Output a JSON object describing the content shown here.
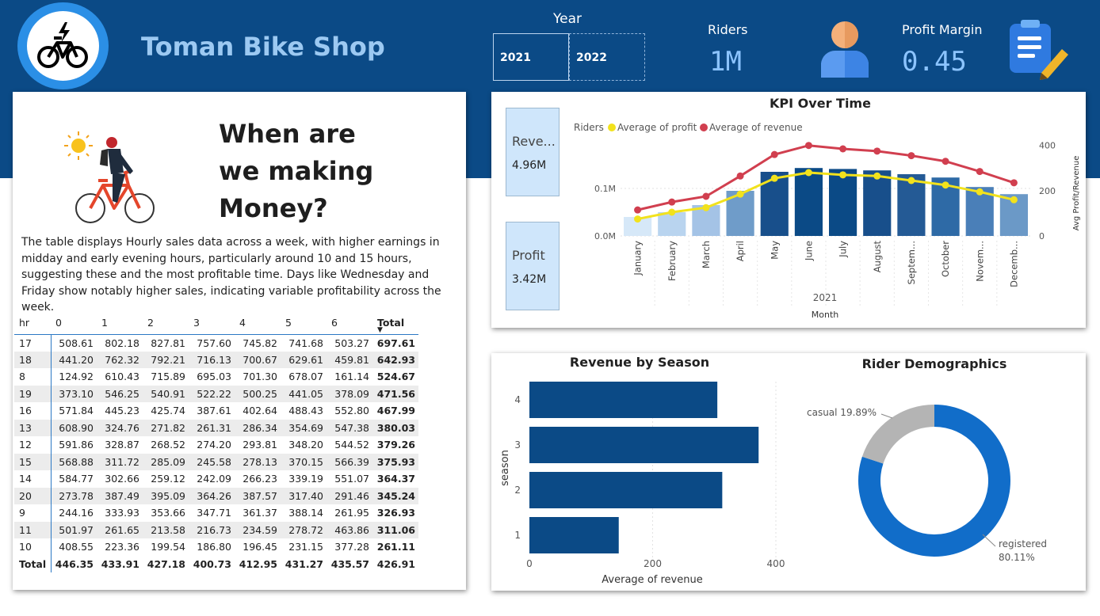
{
  "header": {
    "title": "Toman Bike Shop",
    "year_label": "Year",
    "years": [
      "2021",
      "2022"
    ],
    "selected_year": "2021",
    "riders_label": "Riders",
    "riders_value": "1M",
    "profit_margin_label": "Profit Margin",
    "profit_margin_value": "0.45",
    "icons": [
      "bike-logo-icon",
      "user-icon",
      "clipboard-icon"
    ]
  },
  "info_card": {
    "headline_lines": [
      "When are",
      "we making",
      "Money?"
    ],
    "description": "The table displays Hourly sales data across a week, with higher earnings in midday and early evening hours, particularly around 10 and 15 hours, suggesting these and the most profitable time. Days like Wednesday and Friday show notably higher sales, indicating variable profitability across the week."
  },
  "hourly_table": {
    "columns": [
      "hr",
      "0",
      "1",
      "2",
      "3",
      "4",
      "5",
      "6",
      "Total"
    ],
    "sorted_column": "Total",
    "rows": [
      [
        "17",
        "508.61",
        "802.18",
        "827.81",
        "757.60",
        "745.82",
        "741.68",
        "503.27",
        "697.61"
      ],
      [
        "18",
        "441.20",
        "762.32",
        "792.21",
        "716.13",
        "700.67",
        "629.61",
        "459.81",
        "642.93"
      ],
      [
        "8",
        "124.92",
        "610.43",
        "715.89",
        "695.03",
        "701.30",
        "678.07",
        "161.14",
        "524.67"
      ],
      [
        "19",
        "373.10",
        "546.25",
        "540.91",
        "522.22",
        "500.25",
        "441.05",
        "378.09",
        "471.56"
      ],
      [
        "16",
        "571.84",
        "445.23",
        "425.74",
        "387.61",
        "402.64",
        "488.43",
        "552.80",
        "467.99"
      ],
      [
        "13",
        "608.90",
        "324.76",
        "271.82",
        "261.31",
        "286.34",
        "354.69",
        "547.38",
        "380.03"
      ],
      [
        "12",
        "591.86",
        "328.87",
        "268.52",
        "274.20",
        "293.81",
        "348.20",
        "544.52",
        "379.26"
      ],
      [
        "15",
        "568.88",
        "311.72",
        "285.09",
        "245.58",
        "278.13",
        "370.15",
        "566.39",
        "375.93"
      ],
      [
        "14",
        "584.77",
        "302.66",
        "259.12",
        "242.09",
        "266.23",
        "339.19",
        "551.07",
        "364.37"
      ],
      [
        "20",
        "273.78",
        "387.49",
        "395.09",
        "364.26",
        "387.57",
        "317.40",
        "291.46",
        "345.24"
      ],
      [
        "9",
        "244.16",
        "333.93",
        "353.66",
        "347.71",
        "361.37",
        "388.14",
        "261.95",
        "326.93"
      ],
      [
        "11",
        "501.97",
        "261.65",
        "213.58",
        "216.73",
        "234.59",
        "278.72",
        "463.86",
        "311.06"
      ],
      [
        "10",
        "408.55",
        "223.36",
        "199.54",
        "186.80",
        "196.45",
        "231.15",
        "377.28",
        "261.11"
      ]
    ],
    "total_row": [
      "Total",
      "446.35",
      "433.91",
      "427.18",
      "400.73",
      "412.95",
      "431.27",
      "435.57",
      "426.91"
    ]
  },
  "kpi_cards": {
    "revenue_label": "Reve...",
    "revenue_value": "4.96M",
    "profit_label": "Profit",
    "profit_value": "3.42M"
  },
  "colors": {
    "header_bg": "#0b4a86",
    "riders_bar": "#0b4a86",
    "profit_line": "#f2e21c",
    "revenue_line": "#d13f4f",
    "season_bar": "#0b4a86",
    "registered": "#116dc9",
    "casual": "#b4b4b4"
  },
  "chart_data": [
    {
      "type": "bar",
      "title": "KPI Over Time",
      "legend": [
        "Riders",
        "Average of profit",
        "Average of revenue"
      ],
      "legend_position": "top-left",
      "categories": [
        "January",
        "February",
        "March",
        "April",
        "May",
        "June",
        "July",
        "August",
        "Septem...",
        "October",
        "Novem...",
        "Decemb..."
      ],
      "xlabel": "Month",
      "x_group_label": "2021",
      "y_left_ticks": [
        "0.0M",
        "0.1M"
      ],
      "y_left_range": [
        0,
        0.2
      ],
      "y_right_label": "Avg Profit/Revenue",
      "y_right_ticks": [
        "0",
        "200",
        "400"
      ],
      "y_right_range": [
        0,
        420
      ],
      "series": [
        {
          "name": "Riders",
          "values": [
            0.04,
            0.05,
            0.065,
            0.095,
            0.135,
            0.143,
            0.141,
            0.138,
            0.13,
            0.123,
            0.103,
            0.088
          ]
        },
        {
          "name": "Average of profit",
          "values": [
            75,
            105,
            125,
            185,
            255,
            280,
            270,
            265,
            245,
            225,
            195,
            160
          ]
        },
        {
          "name": "Average of revenue",
          "values": [
            115,
            150,
            175,
            265,
            360,
            400,
            385,
            375,
            355,
            330,
            285,
            235
          ]
        }
      ],
      "grid": true
    },
    {
      "type": "bar",
      "orientation": "horizontal",
      "title": "Revenue by Season",
      "categories": [
        "4",
        "3",
        "2",
        "1"
      ],
      "values": [
        305,
        372,
        313,
        145
      ],
      "xlabel": "Average of revenue",
      "ylabel": "season",
      "x_ticks": [
        "0",
        "200",
        "400"
      ],
      "xlim": [
        0,
        400
      ],
      "grid": true
    },
    {
      "type": "pie",
      "donut": true,
      "title": "Rider Demographics",
      "labels": [
        "registered",
        "casual"
      ],
      "values": [
        80.11,
        19.89
      ],
      "value_labels": [
        "80.11%",
        "19.89%"
      ],
      "label_texts": [
        "casual 19.89%"
      ]
    }
  ]
}
